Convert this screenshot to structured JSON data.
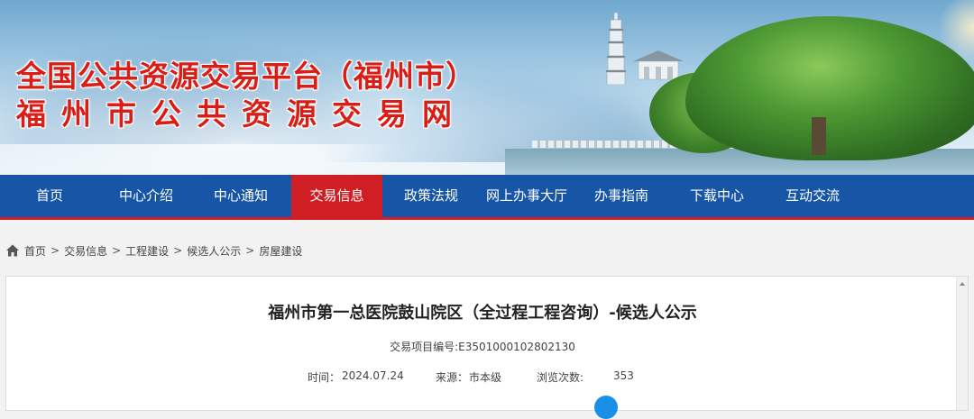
{
  "header": {
    "title_line1": "全国公共资源交易平台（福州市）",
    "title_line2": "福州市公共资源交易网",
    "title_color": "#d81e16"
  },
  "nav": {
    "background": "#1755a6",
    "active_color": "#cf1f25",
    "items": [
      {
        "label": "首页"
      },
      {
        "label": "中心介绍"
      },
      {
        "label": "中心通知"
      },
      {
        "label": "交易信息",
        "active": true
      },
      {
        "label": "政策法规"
      },
      {
        "label": "网上办事大厅"
      },
      {
        "label": "办事指南"
      },
      {
        "label": "下载中心"
      },
      {
        "label": "互动交流"
      }
    ]
  },
  "breadcrumb": {
    "icon": "home-icon",
    "items": [
      "首页",
      "交易信息",
      "工程建设",
      "候选人公示",
      "房屋建设"
    ],
    "separator": ">"
  },
  "article": {
    "title": "福州市第一总医院鼓山院区（全过程工程咨询）-候选人公示",
    "project_no": "交易项目编号:E3501000102802130",
    "time_label": "时间：",
    "time_value": "2024.07.24",
    "source_label": "来源：",
    "source_value": "市本级",
    "views_label": "浏览次数:",
    "views_value": "353"
  }
}
